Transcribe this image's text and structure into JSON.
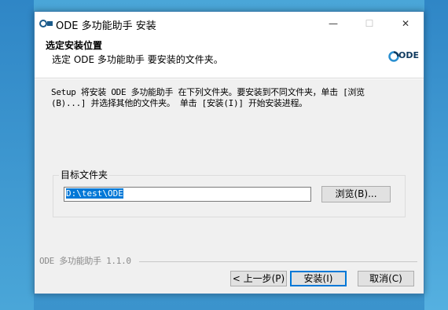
{
  "window": {
    "title": "ODE 多功能助手 安装",
    "controls": {
      "minimize": "—",
      "maximize": "☐",
      "close": "✕"
    }
  },
  "header": {
    "title": "选定安装位置",
    "subtitle": "选定 ODE 多功能助手 要安装的文件夹。",
    "logo_text": "ODE"
  },
  "body": {
    "description": "Setup 将安装 ODE 多功能助手 在下列文件夹。要安装到不同文件夹，单击 [浏览\n(B)...] 并选择其他的文件夹。 单击 [安装(I)] 开始安装进程。",
    "destination_group_label": "目标文件夹",
    "destination_path": "D:\\test\\ODE",
    "browse_label": "浏览(B)..."
  },
  "footer": {
    "branding": "ODE 多功能助手 1.1.0",
    "back_label": "< 上一步(P)",
    "install_label": "安装(I)",
    "cancel_label": "取消(C)"
  },
  "colors": {
    "accent": "#0078d7",
    "desktop": "#3b93cc"
  }
}
